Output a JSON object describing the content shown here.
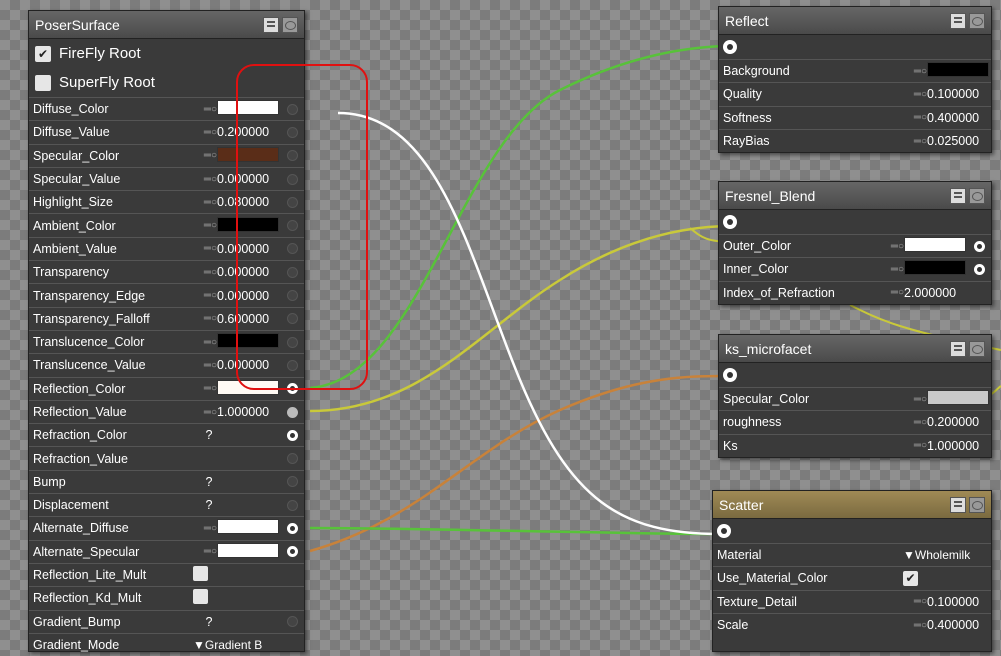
{
  "poser": {
    "title": "PoserSurface",
    "firefly": "FireFly Root",
    "superfly": "SuperFly Root",
    "params": [
      {
        "label": "Diffuse_Color",
        "kind": "color",
        "color": "#ffffff",
        "socket": "off"
      },
      {
        "label": "Diffuse_Value",
        "kind": "num",
        "value": "0.200000",
        "socket": "off"
      },
      {
        "label": "Specular_Color",
        "kind": "color",
        "color": "#5a2d18",
        "socket": "off"
      },
      {
        "label": "Specular_Value",
        "kind": "num",
        "value": "0.000000",
        "socket": "off"
      },
      {
        "label": "Highlight_Size",
        "kind": "num",
        "value": "0.080000",
        "socket": "off"
      },
      {
        "label": "Ambient_Color",
        "kind": "color",
        "color": "#000000",
        "socket": "off"
      },
      {
        "label": "Ambient_Value",
        "kind": "num",
        "value": "0.000000",
        "socket": "off"
      },
      {
        "label": "Transparency",
        "kind": "num",
        "value": "0.000000",
        "socket": "off"
      },
      {
        "label": "Transparency_Edge",
        "kind": "num",
        "value": "0.000000",
        "socket": "off"
      },
      {
        "label": "Transparency_Falloff",
        "kind": "num",
        "value": "0.600000",
        "socket": "off"
      },
      {
        "label": "Translucence_Color",
        "kind": "color",
        "color": "#000000",
        "socket": "off"
      },
      {
        "label": "Translucence_Value",
        "kind": "num",
        "value": "0.000000",
        "socket": "off"
      },
      {
        "label": "Reflection_Color",
        "kind": "color",
        "color": "#fffaf4",
        "socket": "on"
      },
      {
        "label": "Reflection_Value",
        "kind": "num",
        "value": "1.000000",
        "socket": "half"
      },
      {
        "label": "Refraction_Color",
        "kind": "q",
        "value": "?",
        "socket": "on"
      },
      {
        "label": "Refraction_Value",
        "kind": "none",
        "socket": "off"
      },
      {
        "label": "Bump",
        "kind": "q",
        "value": "?",
        "socket": "off"
      },
      {
        "label": "Displacement",
        "kind": "q",
        "value": "?",
        "socket": "off"
      },
      {
        "label": "Alternate_Diffuse",
        "kind": "color",
        "color": "#ffffff",
        "socket": "on"
      },
      {
        "label": "Alternate_Specular",
        "kind": "color",
        "color": "#ffffff",
        "socket": "on"
      },
      {
        "label": "Reflection_Lite_Mult",
        "kind": "check",
        "socket": "none"
      },
      {
        "label": "Reflection_Kd_Mult",
        "kind": "check",
        "socket": "none"
      },
      {
        "label": "Gradient_Bump",
        "kind": "q",
        "value": "?",
        "socket": "off"
      },
      {
        "label": "Gradient_Mode",
        "kind": "sel",
        "value": "▼Gradient B",
        "socket": "none"
      }
    ]
  },
  "reflect": {
    "title": "Reflect",
    "params": [
      {
        "label": "Background",
        "kind": "color",
        "color": "#000000"
      },
      {
        "label": "Quality",
        "kind": "num",
        "value": "0.100000"
      },
      {
        "label": "Softness",
        "kind": "num",
        "value": "0.400000"
      },
      {
        "label": "RayBias",
        "kind": "num",
        "value": "0.025000"
      }
    ]
  },
  "fresnel": {
    "title": "Fresnel_Blend",
    "params": [
      {
        "label": "Outer_Color",
        "kind": "color",
        "color": "#ffffff",
        "socket": "on"
      },
      {
        "label": "Inner_Color",
        "kind": "color",
        "color": "#000000",
        "socket": "on"
      },
      {
        "label": "Index_of_Refraction",
        "kind": "num",
        "value": "2.000000"
      }
    ]
  },
  "ks": {
    "title": "ks_microfacet",
    "params": [
      {
        "label": "Specular_Color",
        "kind": "color",
        "color": "#c8c8c8"
      },
      {
        "label": "roughness",
        "kind": "num",
        "value": "0.200000"
      },
      {
        "label": "Ks",
        "kind": "num",
        "value": "1.000000"
      }
    ]
  },
  "scatter": {
    "title": "Scatter",
    "params": [
      {
        "label": "Material",
        "kind": "sel",
        "value": "▼Wholemilk"
      },
      {
        "label": "Use_Material_Color",
        "kind": "check",
        "checked": "✔"
      },
      {
        "label": "Texture_Detail",
        "kind": "num",
        "value": "0.100000"
      },
      {
        "label": "Scale",
        "kind": "num",
        "value": "0.400000"
      }
    ]
  },
  "icons": {
    "checked": "✔",
    "key": "═○"
  },
  "colors": {
    "wire_green": "#58c23a",
    "wire_yellow": "#c9c93a",
    "wire_orange": "#c8823a",
    "wire_white": "#ffffff",
    "annotation": "#e01010"
  }
}
